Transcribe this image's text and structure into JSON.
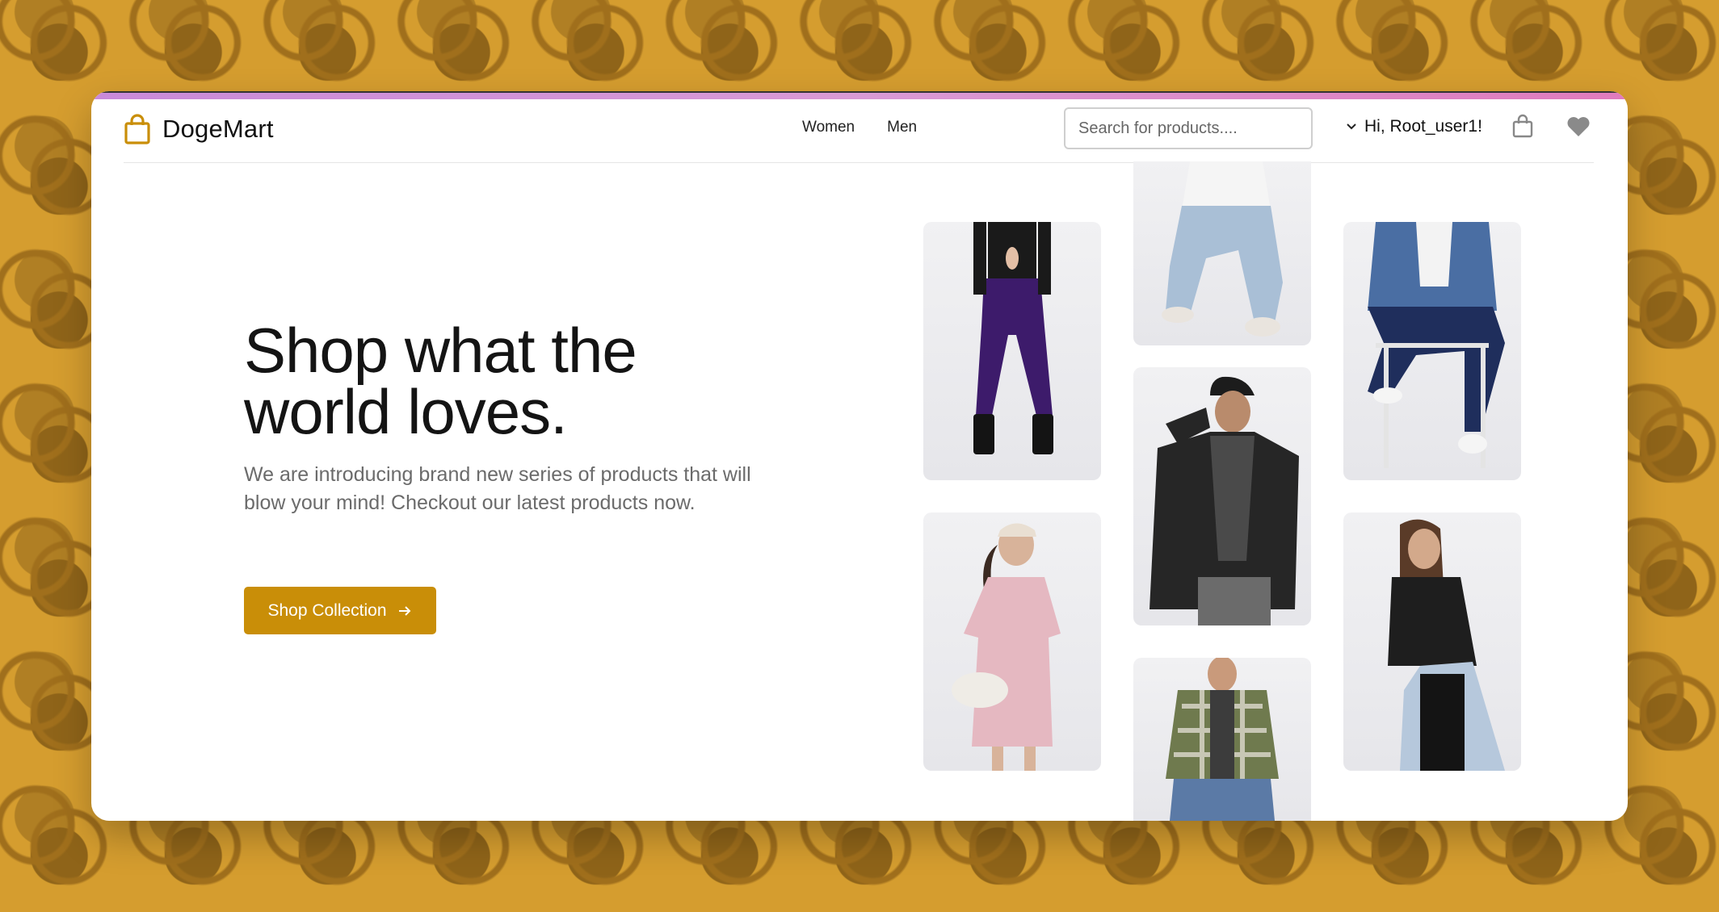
{
  "brand": {
    "name": "DogeMart",
    "accent": "#c98e08"
  },
  "nav": {
    "women": "Women",
    "men": "Men"
  },
  "search": {
    "placeholder": "Search for products...."
  },
  "user": {
    "greeting": "Hi, Root_user1!"
  },
  "icons": {
    "logo": "shopping-bag-icon",
    "user_menu": "chevron-down-icon",
    "cart": "shopping-bag-icon",
    "wishlist": "heart-icon",
    "cta": "arrow-right-icon"
  },
  "hero": {
    "title": "Shop what the world loves.",
    "subtitle": "We are introducing brand new series of products that will blow your mind! Checkout our latest products now.",
    "cta_label": "Shop Collection"
  },
  "colors": {
    "background": "#d59d2f",
    "pattern": "#a06f1c",
    "accent_bar": "#d99ad5"
  }
}
